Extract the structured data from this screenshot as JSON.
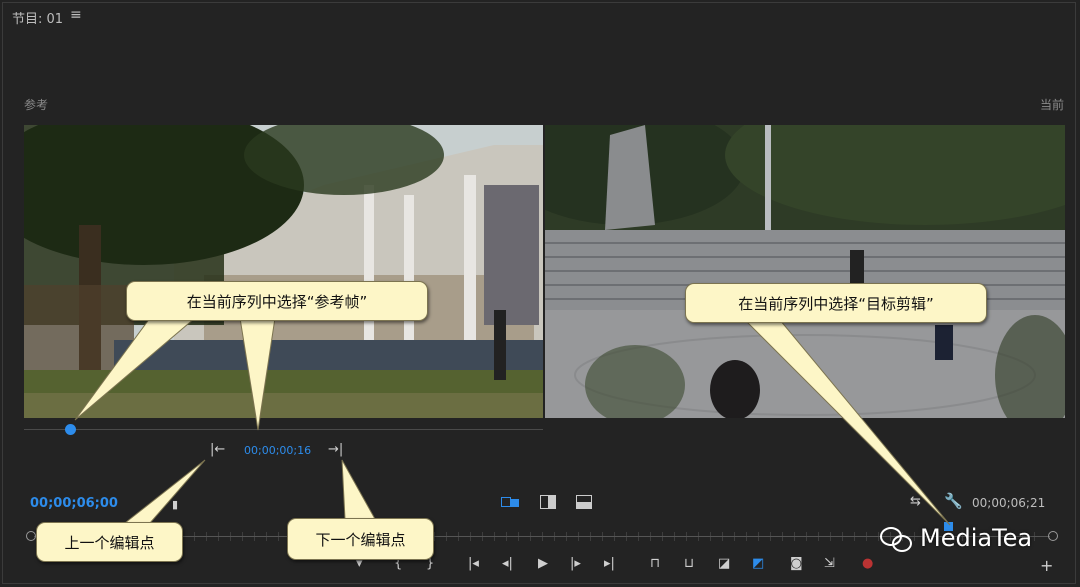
{
  "panel": {
    "title": "节目: 01",
    "menu_icon": "hamburger-menu-icon",
    "label_reference": "参考",
    "label_current": "当前"
  },
  "timecodes": {
    "mid": "00;00;00;16",
    "left": "00;00;06;00",
    "right": "00;00;06;21"
  },
  "callouts": {
    "reference": "在当前序列中选择“参考帧”",
    "target": "在当前序列中选择“目标剪辑”",
    "prev_edit": "上一个编辑点",
    "next_edit": "下一个编辑点"
  },
  "watermark": "MediaTea",
  "colors": {
    "accent": "#2d8ceb",
    "callout_bg": "#fdf6c7",
    "background": "#232323"
  }
}
